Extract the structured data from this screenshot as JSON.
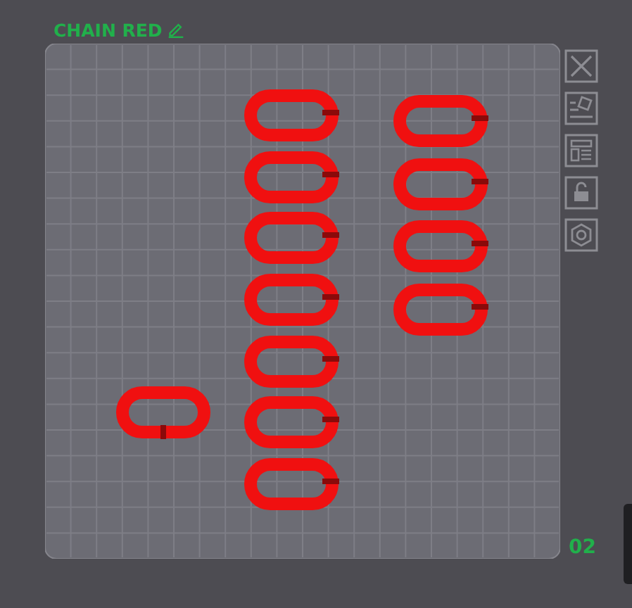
{
  "plate": {
    "title": "CHAIN RED",
    "number": "02"
  }
}
